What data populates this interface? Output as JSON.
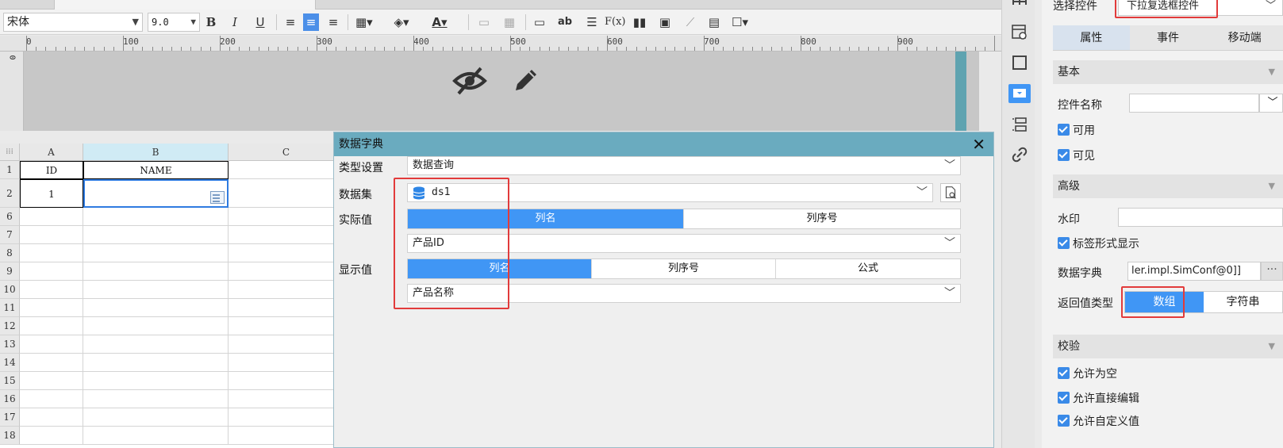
{
  "toolbar": {
    "font_family": "宋体",
    "font_size": "9.0",
    "bold": "B",
    "italic": "I",
    "underline": "U",
    "formula": "F(x)",
    "ab": "ab"
  },
  "ruler": {
    "labels": [
      "0",
      "100",
      "200",
      "300",
      "400",
      "500",
      "600",
      "700",
      "800",
      "900"
    ],
    "vertical_label": "0"
  },
  "sheet": {
    "columns": [
      "A",
      "B",
      "C"
    ],
    "rows": [
      "1",
      "2",
      "6",
      "7",
      "8",
      "9",
      "10",
      "11",
      "12",
      "13",
      "14",
      "15",
      "16",
      "17",
      "18"
    ],
    "header_cells": {
      "a1": "ID",
      "b1": "NAME"
    },
    "data_cells": {
      "a2": "1",
      "b2": ""
    }
  },
  "dialog": {
    "title": "数据字典",
    "type_label": "类型设置",
    "type_value": "数据查询",
    "dataset_label": "数据集",
    "dataset_value": "ds1",
    "actual_label": "实际值",
    "actual_tabs": [
      "列名",
      "列序号"
    ],
    "actual_value": "产品ID",
    "display_label": "显示值",
    "display_tabs": [
      "列名",
      "列序号",
      "公式"
    ],
    "display_value": "产品名称"
  },
  "panel": {
    "select_control_label": "选择控件",
    "select_control_value": "下拉复选框控件",
    "tabs": [
      "属性",
      "事件",
      "移动端"
    ],
    "basic_section": "基本",
    "control_name_label": "控件名称",
    "control_name_value": "",
    "enabled_label": "可用",
    "visible_label": "可见",
    "advanced_section": "高级",
    "watermark_label": "水印",
    "watermark_value": "",
    "label_form_label": "标签形式显示",
    "dict_label": "数据字典",
    "dict_value": "ler.impl.SimConf@0]]",
    "dict_button": "···",
    "return_type_label": "返回值类型",
    "return_options": [
      "数组",
      "字符串"
    ],
    "validation_section": "校验",
    "allow_empty_label": "允许为空",
    "allow_edit_label": "允许直接编辑",
    "allow_custom_label": "允许自定义值"
  },
  "colors": {
    "accent": "#4096f5",
    "dialog_title": "#6aabbf",
    "highlight": "#e23b3b"
  }
}
